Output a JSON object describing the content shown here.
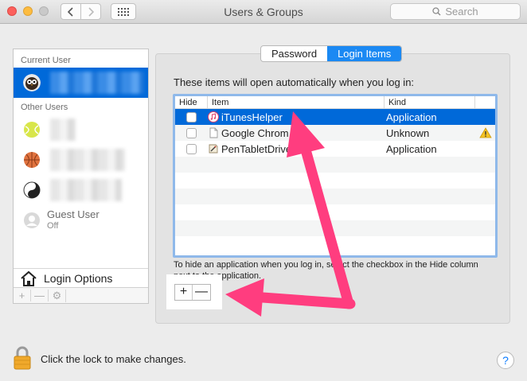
{
  "window": {
    "title": "Users & Groups"
  },
  "search": {
    "placeholder": "Search"
  },
  "sidebar": {
    "current_user_header": "Current User",
    "other_users_header": "Other Users",
    "guest": {
      "name": "Guest User",
      "status": "Off"
    },
    "login_options_label": "Login Options",
    "bottom_buttons": [
      "+",
      "—",
      "⚙"
    ]
  },
  "tabs": {
    "password": "Password",
    "login_items": "Login Items",
    "selected": "Login Items"
  },
  "main": {
    "description": "These items will open automatically when you log in:",
    "columns": [
      "Hide",
      "Item",
      "Kind"
    ],
    "rows": [
      {
        "name": "iTunesHelper",
        "kind": "Application",
        "icon": "itunes-icon",
        "selected": true,
        "warning": false
      },
      {
        "name": "Google Chrome",
        "kind": "Unknown",
        "icon": "document-icon",
        "selected": false,
        "warning": true
      },
      {
        "name": "PenTabletDriver",
        "kind": "Application",
        "icon": "app-icon",
        "selected": false,
        "warning": false
      }
    ],
    "hint": "To hide an application when you log in, select the checkbox in the Hide column next to the application.",
    "add_label": "+",
    "remove_label": "—"
  },
  "footer": {
    "lock_text": "Click the lock to make changes.",
    "help_label": "?"
  },
  "colors": {
    "selection": "#0069d9",
    "annotation": "#ff3d7f",
    "tab_active": "#1b89f3"
  }
}
